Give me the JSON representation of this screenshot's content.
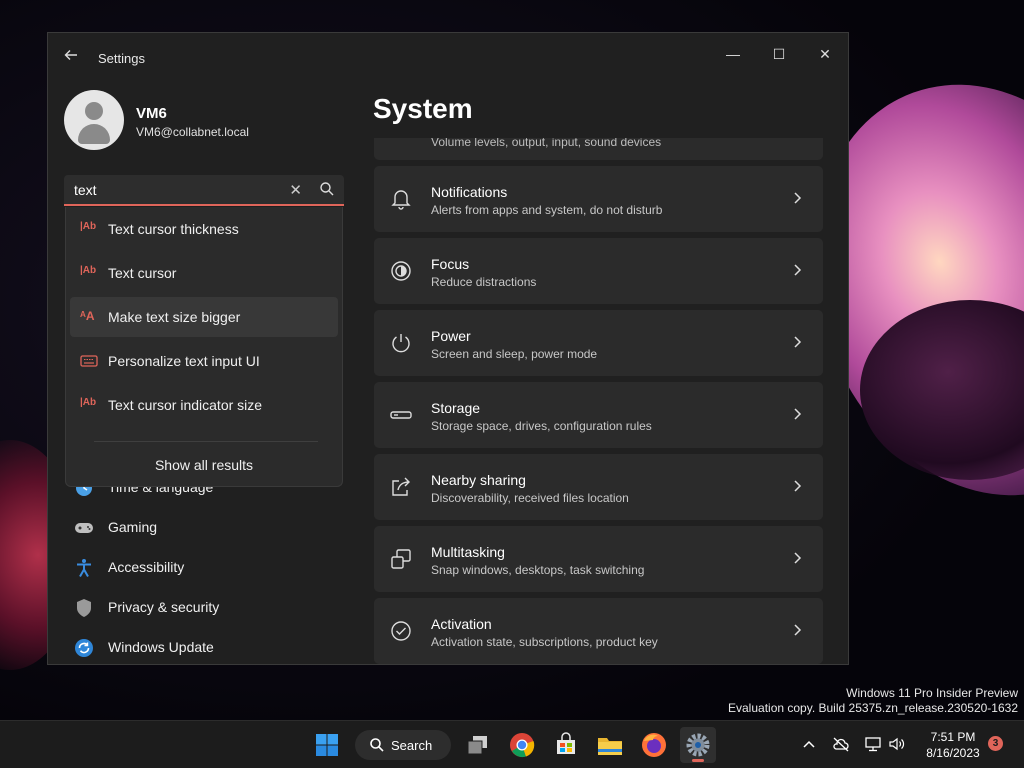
{
  "window": {
    "app_title": "Settings",
    "controls": {
      "minimize": "—",
      "maximize": "☐",
      "close": "✕"
    }
  },
  "user": {
    "name": "VM6",
    "email": "VM6@collabnet.local"
  },
  "search": {
    "value": "text",
    "results": [
      {
        "label": "Text cursor thickness",
        "icon": "text-cursor-icon"
      },
      {
        "label": "Text cursor",
        "icon": "text-cursor-icon"
      },
      {
        "label": "Make text size bigger",
        "icon": "text-size-icon"
      },
      {
        "label": "Personalize text input UI",
        "icon": "keyboard-icon"
      },
      {
        "label": "Text cursor indicator size",
        "icon": "text-cursor-icon"
      }
    ],
    "show_all": "Show all results",
    "hovered_index": 2
  },
  "nav": {
    "items": [
      {
        "label": "Time & language",
        "icon": "clock-globe-icon"
      },
      {
        "label": "Gaming",
        "icon": "gamepad-icon"
      },
      {
        "label": "Accessibility",
        "icon": "accessibility-icon"
      },
      {
        "label": "Privacy & security",
        "icon": "shield-icon"
      },
      {
        "label": "Windows Update",
        "icon": "update-icon"
      }
    ]
  },
  "main": {
    "title": "System",
    "partial_card_sub": "Volume levels, output, input, sound devices",
    "cards": [
      {
        "title": "Notifications",
        "subtitle": "Alerts from apps and system, do not disturb",
        "icon": "bell-icon"
      },
      {
        "title": "Focus",
        "subtitle": "Reduce distractions",
        "icon": "focus-icon"
      },
      {
        "title": "Power",
        "subtitle": "Screen and sleep, power mode",
        "icon": "power-icon"
      },
      {
        "title": "Storage",
        "subtitle": "Storage space, drives, configuration rules",
        "icon": "storage-icon"
      },
      {
        "title": "Nearby sharing",
        "subtitle": "Discoverability, received files location",
        "icon": "share-icon"
      },
      {
        "title": "Multitasking",
        "subtitle": "Snap windows, desktops, task switching",
        "icon": "multitasking-icon"
      },
      {
        "title": "Activation",
        "subtitle": "Activation state, subscriptions, product key",
        "icon": "check-circle-icon"
      }
    ]
  },
  "desktop": {
    "watermark_line1": "Windows 11 Pro Insider Preview",
    "watermark_line2": "Evaluation copy. Build 25375.zn_release.230520-1632"
  },
  "taskbar": {
    "search_label": "Search",
    "clock_time": "7:51 PM",
    "clock_date": "8/16/2023",
    "notification_count": "3"
  },
  "colors": {
    "accent": "#e0655a",
    "window_bg": "#202020",
    "card_bg": "#2b2b2b"
  }
}
